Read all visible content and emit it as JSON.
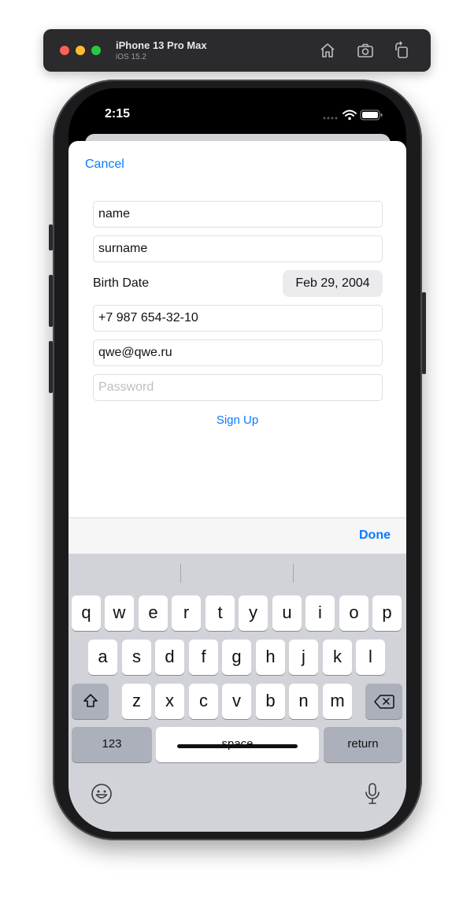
{
  "simulator": {
    "device_name": "iPhone 13 Pro Max",
    "os_version": "iOS 15.2",
    "icons": [
      "home-icon",
      "screenshot-icon",
      "rotate-icon"
    ]
  },
  "status_bar": {
    "time": "2:15"
  },
  "sheet": {
    "cancel_label": "Cancel",
    "fields": {
      "name": "name",
      "surname": "surname",
      "phone": "+7 987 654-32-10",
      "email": "qwe@qwe.ru",
      "password_placeholder": "Password"
    },
    "birth_date_label": "Birth Date",
    "birth_date_value": "Feb 29, 2004",
    "sign_up_label": "Sign Up"
  },
  "toolbar": {
    "done_label": "Done"
  },
  "keyboard": {
    "row1": [
      "q",
      "w",
      "e",
      "r",
      "t",
      "y",
      "u",
      "i",
      "o",
      "p"
    ],
    "row2": [
      "a",
      "s",
      "d",
      "f",
      "g",
      "h",
      "j",
      "k",
      "l"
    ],
    "row3": [
      "z",
      "x",
      "c",
      "v",
      "b",
      "n",
      "m"
    ],
    "numbers_label": "123",
    "space_label": "space",
    "return_label": "return"
  },
  "colors": {
    "accent": "#0a7aff",
    "keyboard_bg": "#d1d3d9",
    "key_dark": "#abb0ba"
  }
}
